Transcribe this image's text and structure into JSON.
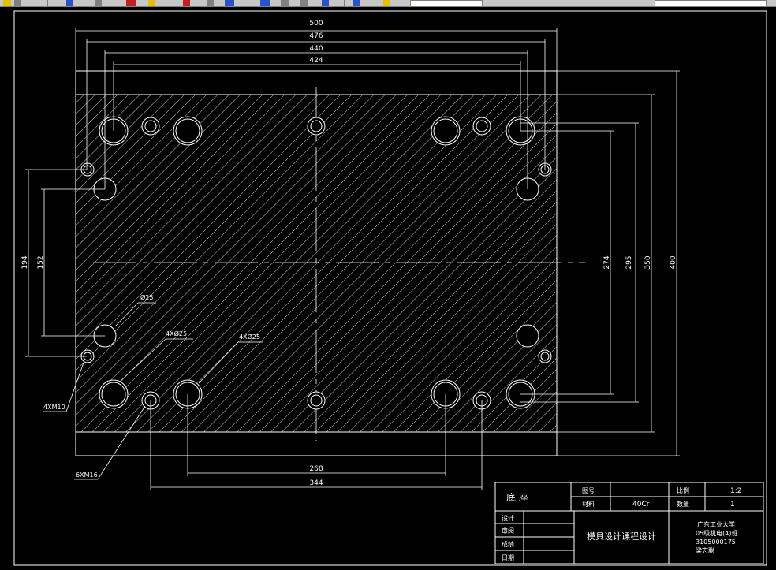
{
  "toolbar": {
    "icons": [
      "open-icon",
      "print-icon",
      "zoom-icon",
      "pan-icon",
      "properties-icon",
      "layer-icon",
      "view-icon",
      "color-icon"
    ],
    "colors": {
      "bg": "#c8c8c8",
      "accent_blue": "#2a55c8",
      "accent_yellow": "#e6c000",
      "accent_red": "#c02020"
    }
  },
  "drawing": {
    "colors": {
      "background": "#000000",
      "lines": "#ffffff"
    },
    "dimensions": {
      "width_500": "500",
      "width_476": "476",
      "width_440": "440",
      "width_424": "424",
      "height_194": "194",
      "height_152": "152",
      "height_274": "274",
      "height_295": "295",
      "height_350": "350",
      "height_400": "400",
      "bottom_268": "268",
      "bottom_344": "344"
    },
    "callouts": {
      "phi25": "Ø25",
      "fourx_phi25_a": "4XØ25",
      "fourx_phi25_b": "4XØ25",
      "fourxm10": "4XM10",
      "sixxm16": "6XM16"
    }
  },
  "title_block": {
    "part_name": "底 座",
    "drawing_no_label": "图号",
    "drawing_no_value": "",
    "scale_label": "比例",
    "scale_value": "1:2",
    "material_label": "材料",
    "material_value": "40Cr",
    "quantity_label": "数量",
    "quantity_value": "1",
    "design_label": "设计",
    "review_label": "审阅",
    "grade_label": "成绩",
    "date_label": "日期",
    "course_title": "模具设计课程设计",
    "school": "广东工业大学",
    "class": "05级机电(4)班",
    "student_id": "3105000175",
    "student_name": "梁志聪"
  }
}
